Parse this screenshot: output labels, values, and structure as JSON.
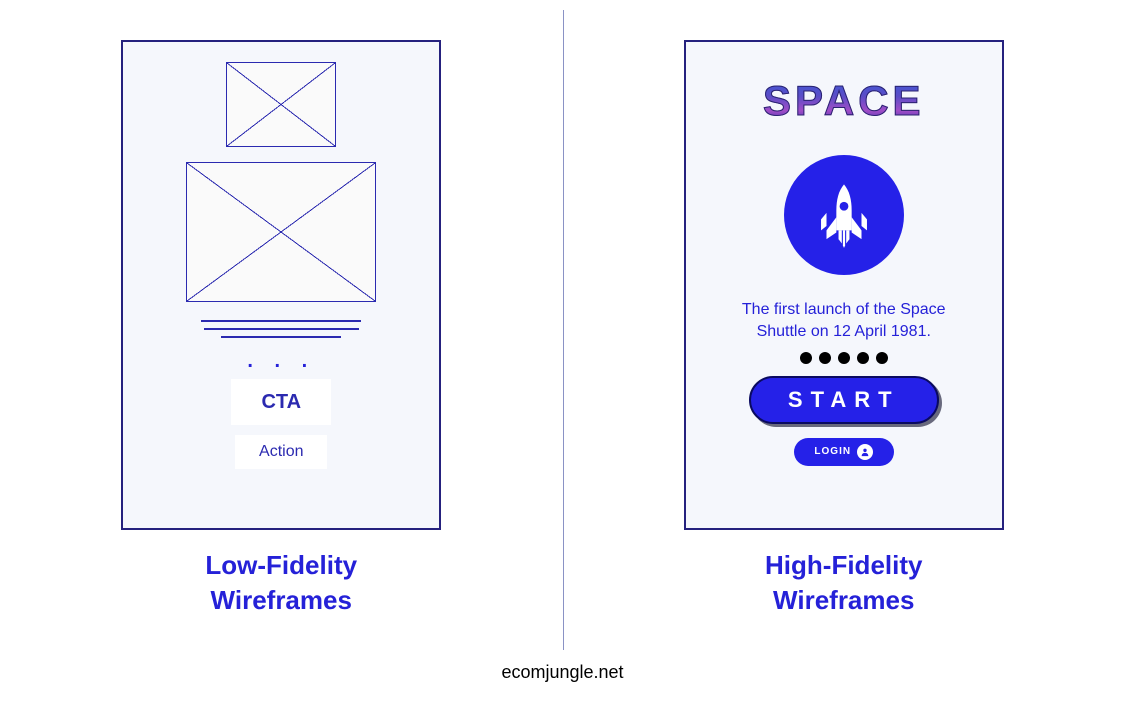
{
  "left": {
    "caption_line1": "Low-Fidelity",
    "caption_line2": "Wireframes",
    "dots": ". . .",
    "cta_label": "CTA",
    "action_label": "Action"
  },
  "right": {
    "caption_line1": "High-Fidelity",
    "caption_line2": "Wireframes",
    "logo_text": "SPACE",
    "description": "The first launch of the Space Shuttle on 12 April 1981.",
    "start_label": "START",
    "login_label": "LOGIN"
  },
  "footer": "ecomjungle.net",
  "colors": {
    "primary": "#2521e8",
    "text_blue": "#2521d8",
    "frame_border": "#25217e",
    "frame_bg": "#f5f7fc"
  }
}
